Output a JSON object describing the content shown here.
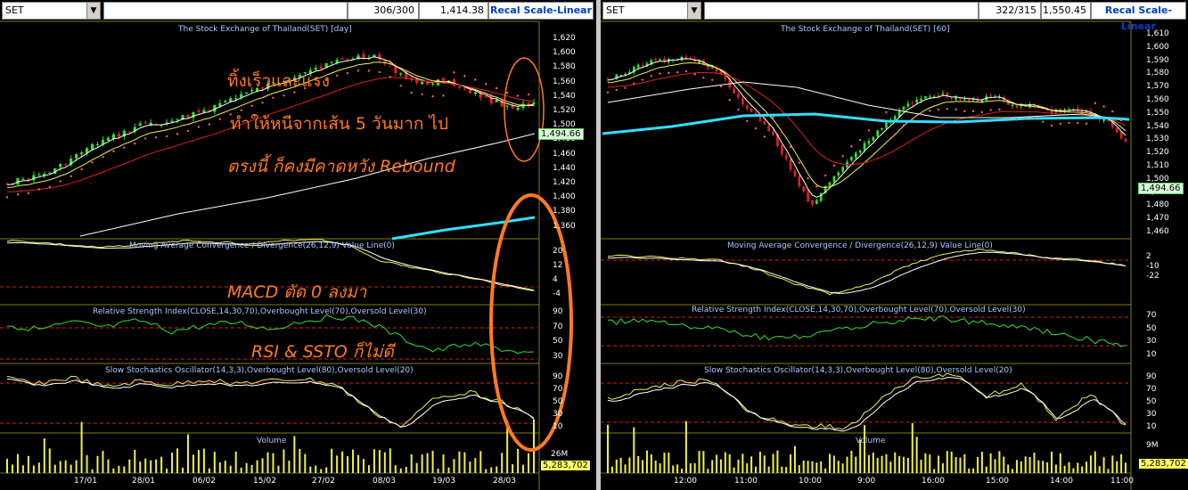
{
  "left": {
    "symbol": "SET",
    "count": "306/300",
    "last_price": "1,414.38",
    "scale_button": "Recal Scale-Linear",
    "price_title": "The Stock Exchange of Thailand(SET) [day]",
    "macd_title": "Moving Average Convergence / Divergence(26,12,9) Value Line(0)",
    "rsi_title": "Relative Strength Index(CLOSE,14,30,70),Overbought Level(70),Oversold Level(30)",
    "sto_title": "Slow Stochastics Oscillator(14,3,3),Overbought Level(80),Oversold Level(20)",
    "volume_title": "Volume",
    "price_axis": [
      "1,620",
      "1,600",
      "1,580",
      "1,560",
      "1,540",
      "1,520",
      "1,500",
      "1,480",
      "1,460",
      "1,440",
      "1,420",
      "1,400",
      "1,380",
      "1,360"
    ],
    "macd_axis": [
      "20",
      "12",
      "4",
      "-4"
    ],
    "rsi_axis": [
      "90",
      "70",
      "50",
      "30"
    ],
    "sto_axis": [
      "90",
      "70",
      "50",
      "30",
      "10"
    ],
    "volume_axis": "26M",
    "current_price": "1,494.66",
    "current_volume": "5,283,702",
    "x_labels": [
      "17/01",
      "28/01",
      "06/02",
      "15/02",
      "27/02",
      "08/03",
      "19/03",
      "28/03"
    ],
    "annotations": {
      "line1": "ทิ้งเร็วและแรง",
      "line2": "ทำให้หนีจากเส้น 5 วันมาก ไป",
      "line3": "ตรงนี้ ก็คงมีคาดหวัง Rebound",
      "macd_note": "MACD ตัด 0 ลงมา",
      "rsi_note": "RSI & SSTO ก็ไม่ดี"
    },
    "annotation_color": "#ff7a20"
  },
  "right": {
    "symbol": "SET",
    "count": "322/315",
    "last_price": "1,550.45",
    "scale_button": "Recal Scale-Linear",
    "price_title": "The Stock Exchange of Thailand(SET) [60]",
    "macd_title": "Moving Average Convergence / Divergence(26,12,9) Value Line(0)",
    "rsi_title": "Relative Strength Index(CLOSE,14,30,70),Overbought Level(70),Oversold Level(30)",
    "sto_title": "Slow Stochastics Oscillator(14,3,3),Overbought Level(80),Oversold Level(20)",
    "volume_title": "Volume",
    "price_axis": [
      "1,610",
      "1,600",
      "1,590",
      "1,580",
      "1,570",
      "1,560",
      "1,550",
      "1,540",
      "1,530",
      "1,520",
      "1,510",
      "1,500",
      "1,490",
      "1,480",
      "1,470",
      "1,460"
    ],
    "macd_axis": [
      "2",
      "-10",
      "-22"
    ],
    "rsi_axis": [
      "70",
      "50",
      "30",
      "10"
    ],
    "sto_axis": [
      "90",
      "70",
      "50",
      "30",
      "10"
    ],
    "volume_axis": "9M",
    "current_price": "1,494.66",
    "current_volume": "5,283,702",
    "x_labels": [
      "12:00",
      "11:00",
      "10:00",
      "9:00",
      "16:00",
      "15:00",
      "14:00",
      "11:00"
    ]
  }
}
